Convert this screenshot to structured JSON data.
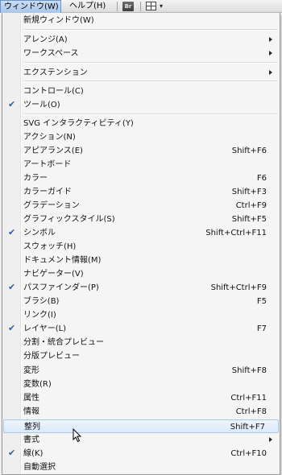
{
  "menubar": {
    "window_label": "ウィンドウ(W)",
    "help_label": "ヘルプ(H)",
    "bridge_label": "Br"
  },
  "menu": {
    "items": [
      {
        "label": "新規ウィンドウ(W)",
        "shortcut": "",
        "checked": false,
        "submenu": false
      },
      {
        "label": "アレンジ(A)",
        "shortcut": "",
        "checked": false,
        "submenu": true
      },
      {
        "label": "ワークスペース",
        "shortcut": "",
        "checked": false,
        "submenu": true
      },
      {
        "label": "エクステンション",
        "shortcut": "",
        "checked": false,
        "submenu": true
      },
      {
        "label": "コントロール(C)",
        "shortcut": "",
        "checked": false,
        "submenu": false
      },
      {
        "label": "ツール(O)",
        "shortcut": "",
        "checked": true,
        "submenu": false
      },
      {
        "label": "SVG インタラクティビティ(Y)",
        "shortcut": "",
        "checked": false,
        "submenu": false
      },
      {
        "label": "アクション(N)",
        "shortcut": "",
        "checked": false,
        "submenu": false
      },
      {
        "label": "アピアランス(E)",
        "shortcut": "Shift+F6",
        "checked": false,
        "submenu": false
      },
      {
        "label": "アートボード",
        "shortcut": "",
        "checked": false,
        "submenu": false
      },
      {
        "label": "カラー",
        "shortcut": "F6",
        "checked": false,
        "submenu": false
      },
      {
        "label": "カラーガイド",
        "shortcut": "Shift+F3",
        "checked": false,
        "submenu": false
      },
      {
        "label": "グラデーション",
        "shortcut": "Ctrl+F9",
        "checked": false,
        "submenu": false
      },
      {
        "label": "グラフィックスタイル(S)",
        "shortcut": "Shift+F5",
        "checked": false,
        "submenu": false
      },
      {
        "label": "シンボル",
        "shortcut": "Shift+Ctrl+F11",
        "checked": true,
        "submenu": false
      },
      {
        "label": "スウォッチ(H)",
        "shortcut": "",
        "checked": false,
        "submenu": false
      },
      {
        "label": "ドキュメント情報(M)",
        "shortcut": "",
        "checked": false,
        "submenu": false
      },
      {
        "label": "ナビゲーター(V)",
        "shortcut": "",
        "checked": false,
        "submenu": false
      },
      {
        "label": "パスファインダー(P)",
        "shortcut": "Shift+Ctrl+F9",
        "checked": true,
        "submenu": false
      },
      {
        "label": "ブラシ(B)",
        "shortcut": "F5",
        "checked": false,
        "submenu": false
      },
      {
        "label": "リンク(I)",
        "shortcut": "",
        "checked": false,
        "submenu": false
      },
      {
        "label": "レイヤー(L)",
        "shortcut": "F7",
        "checked": true,
        "submenu": false
      },
      {
        "label": "分割・統合プレビュー",
        "shortcut": "",
        "checked": false,
        "submenu": false
      },
      {
        "label": "分版プレビュー",
        "shortcut": "",
        "checked": false,
        "submenu": false
      },
      {
        "label": "変形",
        "shortcut": "Shift+F8",
        "checked": false,
        "submenu": false
      },
      {
        "label": "変数(R)",
        "shortcut": "",
        "checked": false,
        "submenu": false
      },
      {
        "label": "属性",
        "shortcut": "Ctrl+F11",
        "checked": false,
        "submenu": false
      },
      {
        "label": "情報",
        "shortcut": "Ctrl+F8",
        "checked": false,
        "submenu": false
      },
      {
        "label": "整列",
        "shortcut": "Shift+F7",
        "checked": false,
        "submenu": false,
        "highlighted": true
      },
      {
        "label": "書式",
        "shortcut": "",
        "checked": false,
        "submenu": true
      },
      {
        "label": "線(K)",
        "shortcut": "Ctrl+F10",
        "checked": true,
        "submenu": false
      },
      {
        "label": "自動選択",
        "shortcut": "",
        "checked": false,
        "submenu": false
      }
    ]
  },
  "colors": {
    "checkmark": "#2f5fa0",
    "highlight_border": "#a9c7ea",
    "menu_background": "#f5f5f5"
  },
  "icons": {
    "check": "check-icon",
    "submenu": "submenu-arrow-icon",
    "cursor": "mouse-cursor-icon"
  }
}
